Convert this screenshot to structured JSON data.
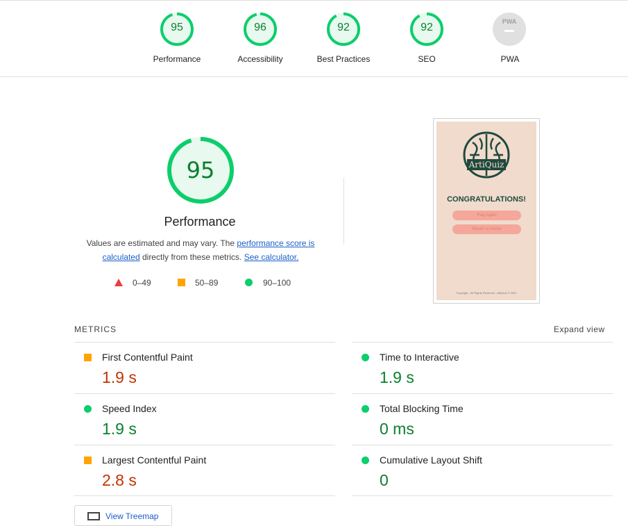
{
  "categories": [
    {
      "score": "95",
      "label": "Performance",
      "fraction": 0.95
    },
    {
      "score": "96",
      "label": "Accessibility",
      "fraction": 0.96
    },
    {
      "score": "92",
      "label": "Best Practices",
      "fraction": 0.92
    },
    {
      "score": "92",
      "label": "SEO",
      "fraction": 0.92
    }
  ],
  "pwa": {
    "badge": "PWA",
    "label": "PWA"
  },
  "performance": {
    "score": "95",
    "fraction": 0.95,
    "title": "Performance",
    "desc_prefix": "Values are estimated and may vary. The ",
    "desc_link1": "performance score is calculated",
    "desc_middle": " directly from these metrics. ",
    "desc_link2": "See calculator."
  },
  "legend": {
    "fail": "0–49",
    "average": "50–89",
    "pass": "90–100"
  },
  "screenshot": {
    "brand": "ArtiQuiz",
    "title": "CONGRATULATIONS!",
    "btn_play": "Play Again",
    "btn_home": "Return to Home",
    "footer": "Copyright - All Rights Reserved - ArtiQuiz © 2022"
  },
  "metrics": {
    "header": "METRICS",
    "expand": "Expand view",
    "items": [
      {
        "name": "First Contentful Paint",
        "value": "1.9 s",
        "rating": "average"
      },
      {
        "name": "Time to Interactive",
        "value": "1.9 s",
        "rating": "pass"
      },
      {
        "name": "Speed Index",
        "value": "1.9 s",
        "rating": "pass"
      },
      {
        "name": "Total Blocking Time",
        "value": "0 ms",
        "rating": "pass"
      },
      {
        "name": "Largest Contentful Paint",
        "value": "2.8 s",
        "rating": "average"
      },
      {
        "name": "Cumulative Layout Shift",
        "value": "0",
        "rating": "pass"
      }
    ]
  },
  "treemap": {
    "label": "View Treemap"
  },
  "colors": {
    "pass": "#0cce6b",
    "average": "#ffa400",
    "fail": "#eb3d3d",
    "pass_text": "#0a7f2e",
    "average_text": "#c33300"
  }
}
